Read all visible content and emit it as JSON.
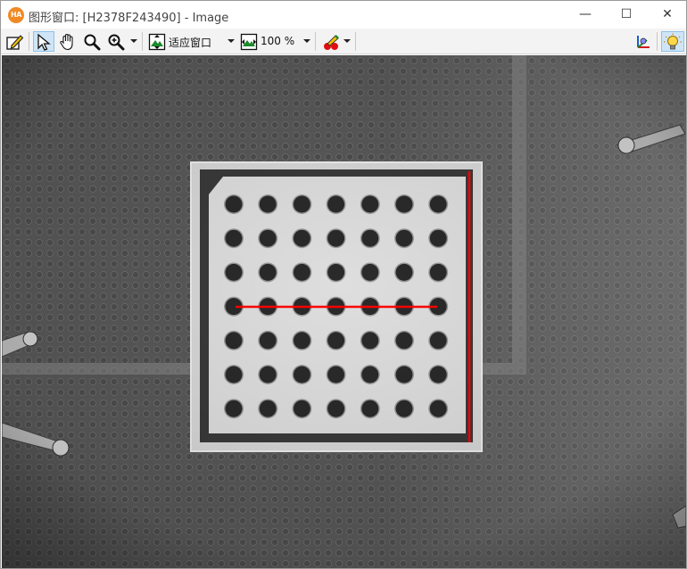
{
  "window": {
    "app_icon_text": "HA",
    "title": "图形窗口: [H2378F243490] - Image",
    "minimize_glyph": "—",
    "maximize_glyph": "☐",
    "close_glyph": "✕"
  },
  "toolbar": {
    "zoom_mode_label": "适应窗口",
    "zoom_percent_label": "100 %"
  },
  "image": {
    "grid_rows": 7,
    "grid_cols": 7,
    "measure_line_color": "#ff0000",
    "dot_color": "#2a2a2a",
    "target_color": "#dcdcdc"
  }
}
